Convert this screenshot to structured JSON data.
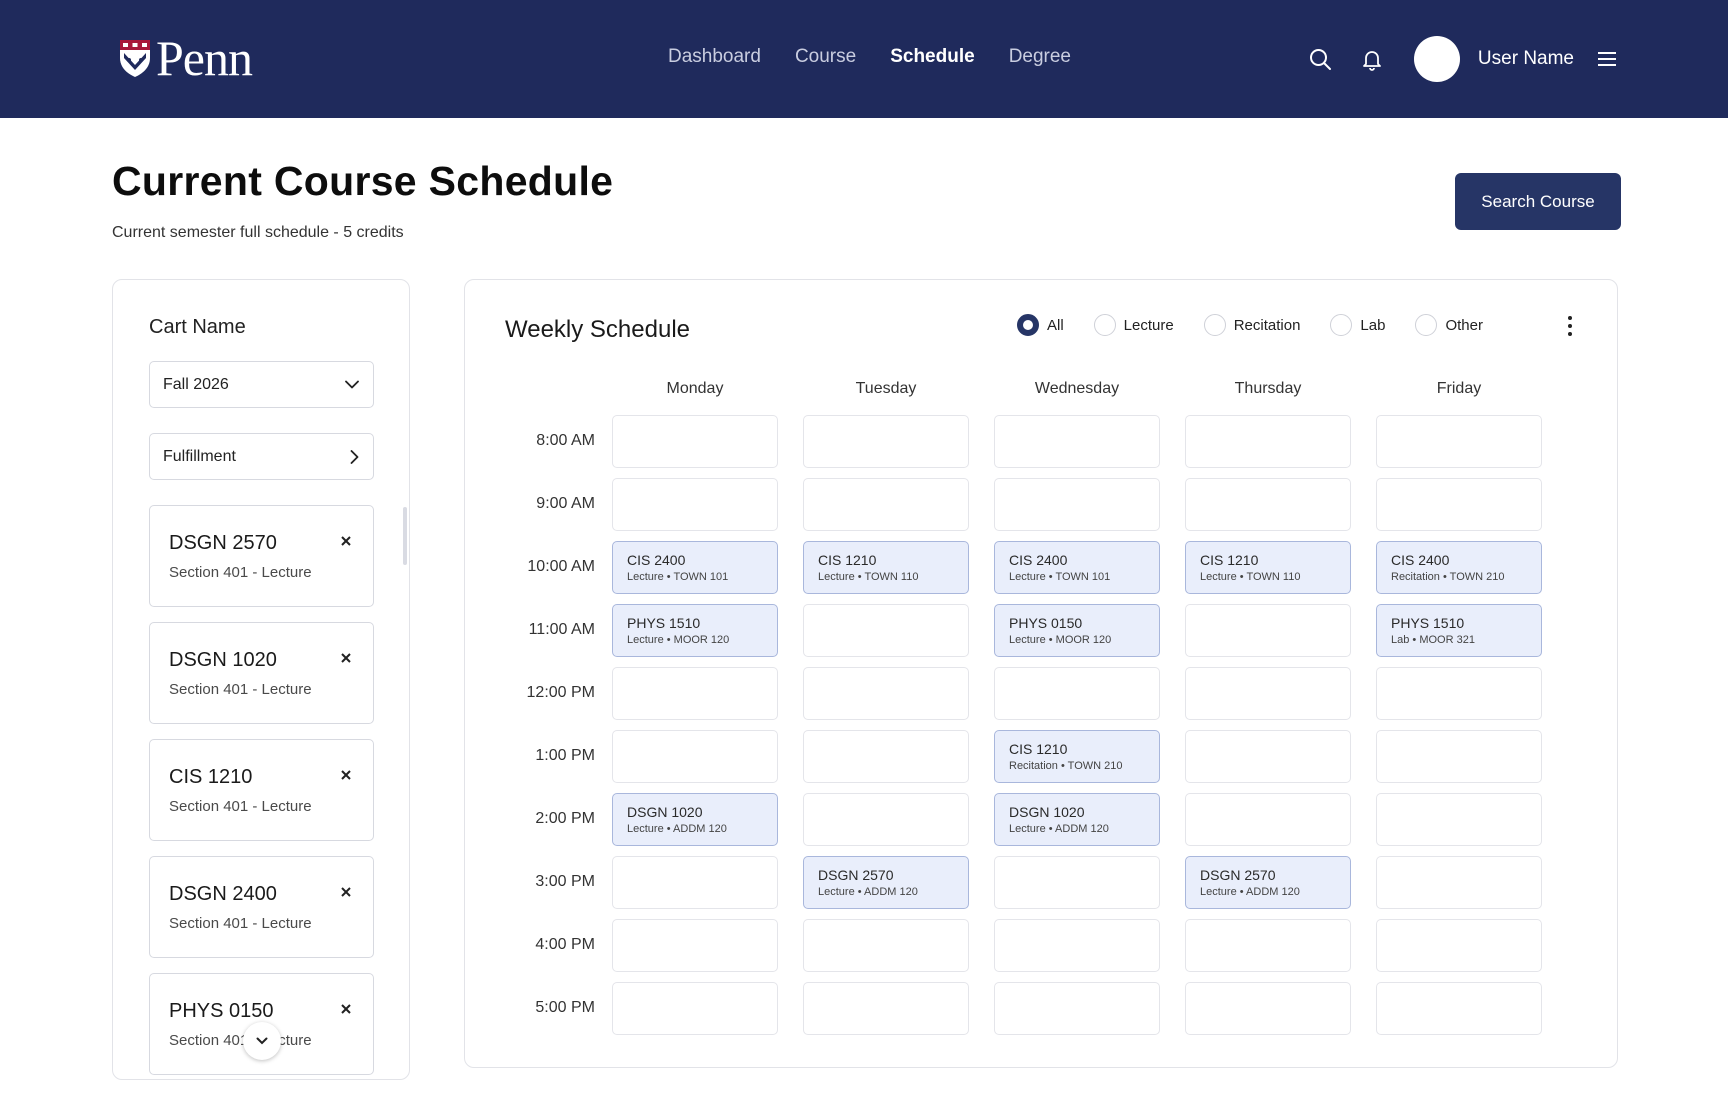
{
  "header": {
    "logo_text": "Penn",
    "nav": [
      {
        "label": "Dashboard"
      },
      {
        "label": "Course"
      },
      {
        "label": "Schedule"
      },
      {
        "label": "Degree"
      }
    ],
    "active_nav": "Schedule",
    "user_name": "User Name"
  },
  "page": {
    "title": "Current Course Schedule",
    "subtitle": "Current semester full schedule - 5 credits",
    "search_button": "Search Course"
  },
  "cart": {
    "label": "Cart Name",
    "selected_term": "Fall 2026",
    "fulfillment_label": "Fulfillment",
    "items": [
      {
        "code": "DSGN 2570",
        "section": "Section 401 - Lecture"
      },
      {
        "code": "DSGN 1020",
        "section": "Section 401 - Lecture"
      },
      {
        "code": "CIS 1210",
        "section": "Section 401 - Lecture"
      },
      {
        "code": "DSGN 2400",
        "section": "Section 401 - Lecture"
      },
      {
        "code": "PHYS 0150",
        "section": "Section 401 - Lecture"
      }
    ]
  },
  "schedule": {
    "title": "Weekly Schedule",
    "filters": [
      {
        "label": "All",
        "checked": true
      },
      {
        "label": "Lecture",
        "checked": false
      },
      {
        "label": "Recitation",
        "checked": false
      },
      {
        "label": "Lab",
        "checked": false
      },
      {
        "label": "Other",
        "checked": false
      }
    ],
    "days": [
      "Monday",
      "Tuesday",
      "Wednesday",
      "Thursday",
      "Friday"
    ],
    "times": [
      "8:00 AM",
      "9:00 AM",
      "10:00 AM",
      "11:00 AM",
      "12:00 PM",
      "1:00 PM",
      "2:00 PM",
      "3:00 PM",
      "4:00 PM",
      "5:00 PM"
    ],
    "events": [
      {
        "day": 0,
        "time": 2,
        "code": "CIS 2400",
        "meta": "Lecture • TOWN 101"
      },
      {
        "day": 1,
        "time": 2,
        "code": "CIS 1210",
        "meta": "Lecture • TOWN 110"
      },
      {
        "day": 2,
        "time": 2,
        "code": "CIS 2400",
        "meta": "Lecture • TOWN 101"
      },
      {
        "day": 3,
        "time": 2,
        "code": "CIS 1210",
        "meta": "Lecture • TOWN 110"
      },
      {
        "day": 4,
        "time": 2,
        "code": "CIS 2400",
        "meta": "Recitation • TOWN 210"
      },
      {
        "day": 0,
        "time": 3,
        "code": "PHYS 1510",
        "meta": "Lecture • MOOR 120"
      },
      {
        "day": 2,
        "time": 3,
        "code": "PHYS 0150",
        "meta": "Lecture • MOOR 120"
      },
      {
        "day": 4,
        "time": 3,
        "code": "PHYS 1510",
        "meta": "Lab • MOOR 321"
      },
      {
        "day": 2,
        "time": 5,
        "code": "CIS 1210",
        "meta": "Recitation • TOWN 210"
      },
      {
        "day": 0,
        "time": 6,
        "code": "DSGN 1020",
        "meta": "Lecture • ADDM 120"
      },
      {
        "day": 2,
        "time": 6,
        "code": "DSGN 1020",
        "meta": "Lecture • ADDM 120"
      },
      {
        "day": 1,
        "time": 7,
        "code": "DSGN 2570",
        "meta": "Lecture • ADDM 120"
      },
      {
        "day": 3,
        "time": 7,
        "code": "DSGN 2570",
        "meta": "Lecture • ADDM 120"
      }
    ]
  },
  "colors": {
    "header_bg": "#1f2a5c",
    "primary": "#263566",
    "event_bg": "#e9eefb",
    "event_border": "#a9b7dc"
  },
  "icons": {
    "logo": "penn-shield-icon",
    "search": "search-icon",
    "notifications": "bell-icon",
    "menu": "hamburger-menu-icon",
    "dropdown": "chevron-down-icon",
    "link": "chevron-right-icon",
    "remove": "close-icon",
    "more": "more-vertical-icon"
  }
}
